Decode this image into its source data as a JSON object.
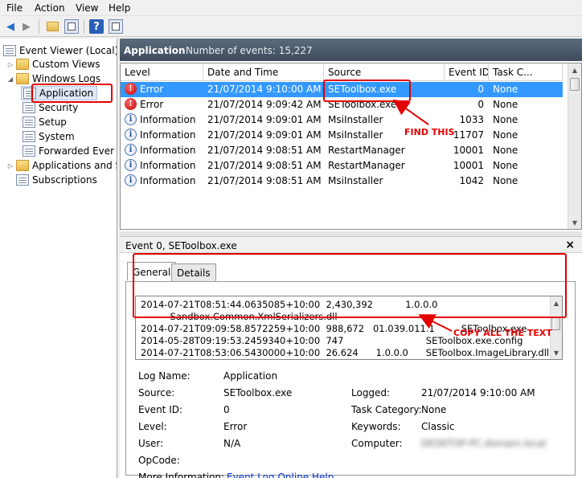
{
  "menu": {
    "file": "File",
    "action": "Action",
    "view": "View",
    "help": "Help"
  },
  "tree": {
    "root": "Event Viewer (Local)",
    "custom_views": "Custom Views",
    "windows_logs": "Windows Logs",
    "application": "Application",
    "security": "Security",
    "setup": "Setup",
    "system": "System",
    "forwarded": "Forwarded Ever",
    "apps_services": "Applications and S",
    "subscriptions": "Subscriptions"
  },
  "header": {
    "title": "Application",
    "count": "Number of events: 15,227"
  },
  "grid": {
    "columns": [
      "Level",
      "Date and Time",
      "Source",
      "Event ID",
      "Task C..."
    ],
    "rows": [
      {
        "level": "Error",
        "icon": "error",
        "date": "21/07/2014 9:10:00 AM",
        "source": "SEToolbox.exe",
        "id": "0",
        "task": "None"
      },
      {
        "level": "Error",
        "icon": "error",
        "date": "21/07/2014 9:09:42 AM",
        "source": "SEToolbox.exe",
        "id": "0",
        "task": "None"
      },
      {
        "level": "Information",
        "icon": "info",
        "date": "21/07/2014 9:09:01 AM",
        "source": "MsiInstaller",
        "id": "1033",
        "task": "None"
      },
      {
        "level": "Information",
        "icon": "info",
        "date": "21/07/2014 9:09:01 AM",
        "source": "MsiInstaller",
        "id": "11707",
        "task": "None"
      },
      {
        "level": "Information",
        "icon": "info",
        "date": "21/07/2014 9:08:51 AM",
        "source": "RestartManager",
        "id": "10001",
        "task": "None"
      },
      {
        "level": "Information",
        "icon": "info",
        "date": "21/07/2014 9:08:51 AM",
        "source": "RestartManager",
        "id": "10001",
        "task": "None"
      },
      {
        "level": "Information",
        "icon": "info",
        "date": "21/07/2014 9:08:51 AM",
        "source": "MsiInstaller",
        "id": "1042",
        "task": "None"
      }
    ]
  },
  "details": {
    "title": "Event 0, SEToolbox.exe",
    "close": "×",
    "tab_general": "General",
    "tab_details": "Details",
    "text_lines": [
      "2014-07-21T08:51:44.0635085+10:00  2,430,392           1.0.0.0",
      "          Sandbox.Common.XmlSerializers.dll",
      "2014-07-21T09:09:58.8572259+10:00  988,672   01.039.011.1         SEToolbox.exe",
      "2014-05-28T09:19:53.2459340+10:00  747                            SEToolbox.exe.config",
      "2014-07-21T08:53:06.5430000+10:00  26.624      1.0.0.0      SEToolbox.ImageLibrary.dll"
    ],
    "log_name_label": "Log Name:",
    "log_name": "Application",
    "source_label": "Source:",
    "source": "SEToolbox.exe",
    "logged_label": "Logged:",
    "logged": "21/07/2014 9:10:00 AM",
    "event_id_label": "Event ID:",
    "event_id": "0",
    "task_cat_label": "Task Category:",
    "task_cat": "None",
    "level_label": "Level:",
    "level": "Error",
    "keywords_label": "Keywords:",
    "keywords": "Classic",
    "user_label": "User:",
    "user": "N/A",
    "computer_label": "Computer:",
    "computer": "DESKTOP-PC.domain.local",
    "opcode_label": "OpCode:",
    "more_info_label": "More Information:",
    "more_info_link": "Event Log Online Help"
  },
  "annotations": {
    "find_this": "FIND THIS",
    "copy_all": "COPY ALL THE TEXT"
  },
  "colors": {
    "annotation": "#e30000",
    "selection": "#3399ff",
    "header": "#4a5868"
  }
}
